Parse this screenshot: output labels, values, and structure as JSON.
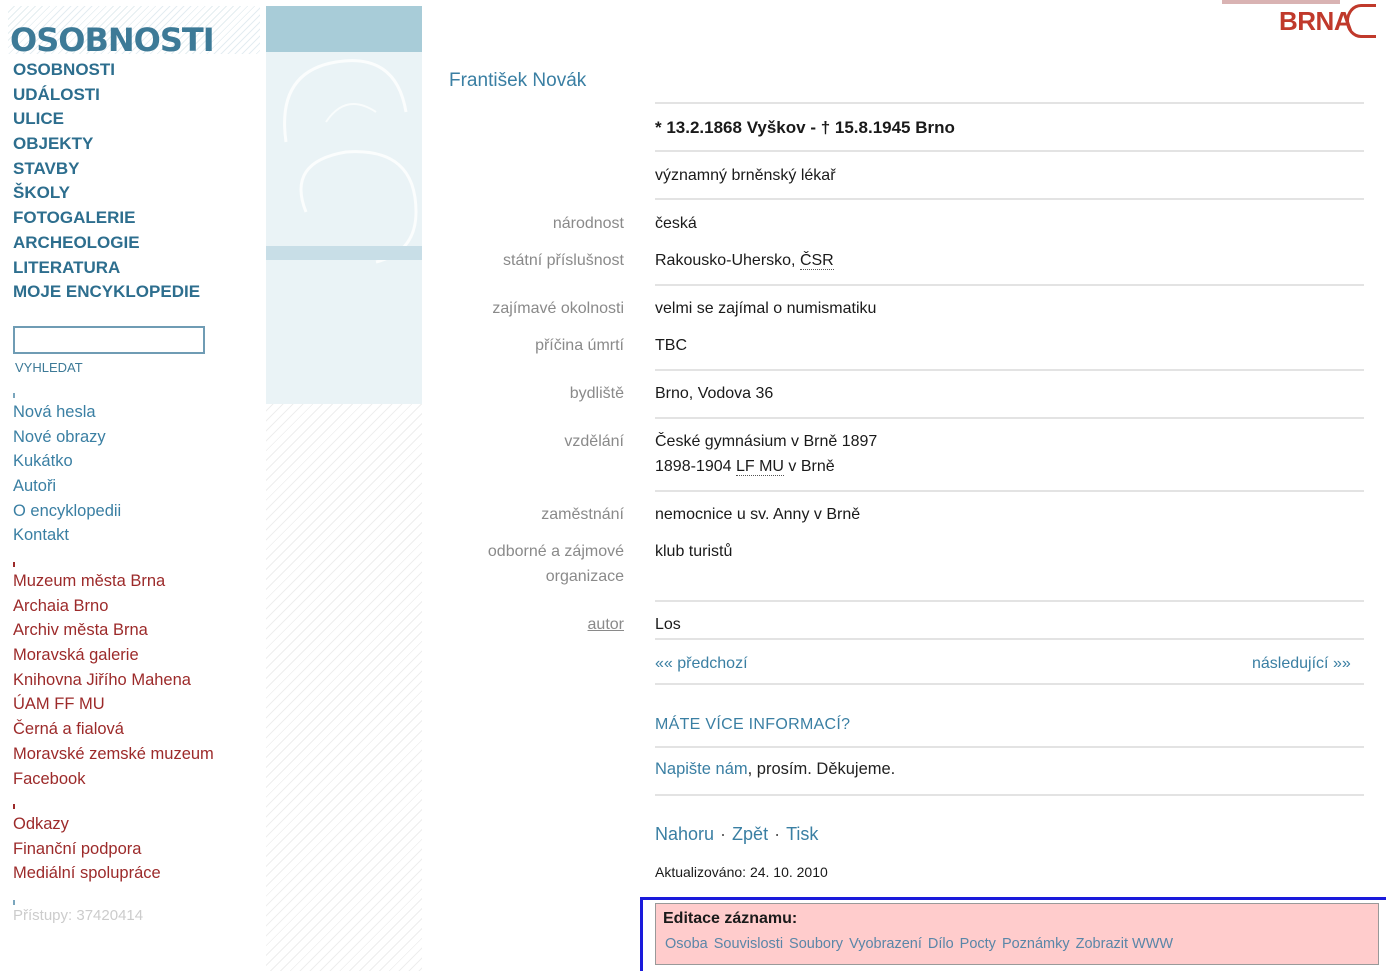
{
  "logo": "OSOBNOSTI",
  "brand": "BRNA",
  "menu_main": [
    "OSOBNOSTI",
    "UDÁLOSTI",
    "ULICE",
    "OBJEKTY",
    "STAVBY",
    "ŠKOLY",
    "FOTOGALERIE",
    "ARCHEOLOGIE",
    "LITERATURA",
    "MOJE ENCYKLOPEDIE"
  ],
  "search": {
    "value": "",
    "button_label": "VYHLEDAT"
  },
  "links_info": [
    "Nová hesla",
    "Nové obrazy",
    "Kukátko",
    "Autoři",
    "O encyklopedii",
    "Kontakt"
  ],
  "links_partners": [
    "Muzeum města Brna",
    "Archaia Brno",
    "Archiv města Brna",
    "Moravská galerie",
    "Knihovna Jiřího Mahena",
    "ÚAM FF MU",
    "Černá a fialová",
    "Moravské zemské muzeum",
    "Facebook"
  ],
  "links_other": [
    "Odkazy",
    "Finanční podpora",
    "Mediální spolupráce"
  ],
  "visits": "Přístupy: 37420414",
  "person": {
    "name": "František Novák",
    "dates": "* 13.2.1868 Vyškov - † 15.8.1945 Brno",
    "description": "významný brněnský lékař"
  },
  "fields": {
    "nationality": {
      "label": "národnost",
      "value": "česká"
    },
    "citizenship": {
      "label": "státní příslušnost",
      "value_prefix": "Rakousko-Uhersko, ",
      "value_abbr": "ČSR"
    },
    "interesting": {
      "label": "zajímavé okolnosti",
      "value": "velmi se zajímal o numismatiku"
    },
    "death_cause": {
      "label": "příčina úmrtí",
      "value": "TBC"
    },
    "residence": {
      "label": "bydliště",
      "value": "Brno, Vodova 36"
    },
    "education": {
      "label": "vzdělání",
      "line1": "České gymnásium v Brně 1897",
      "line2_prefix": "1898-1904 ",
      "line2_abbr": "LF MU",
      "line2_suffix": " v Brně"
    },
    "employment": {
      "label": "zaměstnání",
      "value": "nemocnice u sv. Anny v Brně"
    },
    "organizations": {
      "label_line1": "odborné a zájmové",
      "label_line2": "organizace",
      "value": "klub turistů"
    },
    "author": {
      "label": "autor",
      "value": "Los"
    }
  },
  "pager": {
    "prev": "«« předchozí",
    "next": "následující »»"
  },
  "more_info_heading": "MÁTE VÍCE INFORMACÍ?",
  "write_us": {
    "link": "Napište nám",
    "rest": ", prosím. Děkujeme."
  },
  "footer_links": {
    "top": "Nahoru",
    "back": "Zpět",
    "print": "Tisk",
    "separator": "·"
  },
  "updated": "Aktualizováno: 24. 10. 2010",
  "edit": {
    "title": "Editace záznamu:",
    "links": [
      "Osoba",
      "Souvislosti",
      "Soubory",
      "Vyobrazení",
      "Dílo",
      "Pocty",
      "Poznámky",
      "Zobrazit WWW"
    ]
  }
}
